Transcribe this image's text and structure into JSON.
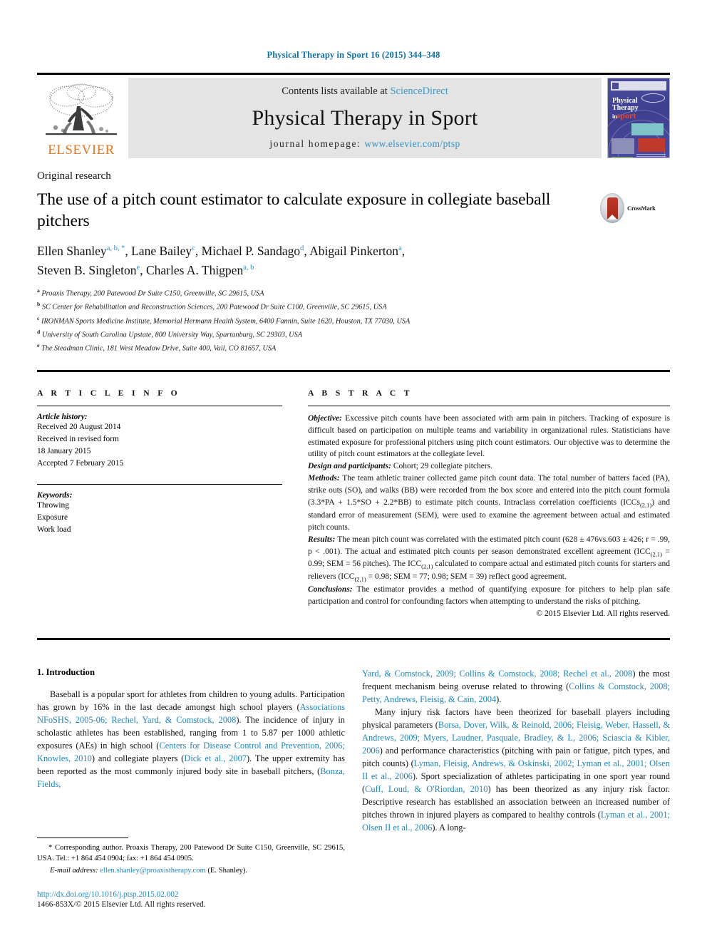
{
  "running_head": "Physical Therapy in Sport 16 (2015) 344–348",
  "masthead": {
    "contents_prefix": "Contents lists available at ",
    "sciencedirect": "ScienceDirect",
    "journal_title": "Physical Therapy in Sport",
    "homepage_prefix": "journal homepage: ",
    "homepage_url": "www.elsevier.com/ptsp",
    "publisher": "ELSEVIER",
    "cover_title_line1": "Physical",
    "cover_title_line2": "Therapy",
    "cover_title_line3_small": "in",
    "cover_title_line3_big": "sport"
  },
  "article": {
    "kicker": "Original research",
    "title": "The use of a pitch count estimator to calculate exposure in collegiate baseball pitchers",
    "crossmark_label": "CrossMark",
    "authors_line1": "Ellen Shanley",
    "authors": [
      {
        "name": "Ellen Shanley",
        "marks": "a, b, *"
      },
      {
        "name": "Lane Bailey",
        "marks": "c"
      },
      {
        "name": "Michael P. Sandago",
        "marks": "d"
      },
      {
        "name": "Abigail Pinkerton",
        "marks": "a"
      },
      {
        "name": "Steven B. Singleton",
        "marks": "e"
      },
      {
        "name": "Charles A. Thigpen",
        "marks": "a, b"
      }
    ],
    "affiliations": [
      {
        "mark": "a",
        "text": "Proaxis Therapy, 200 Patewood Dr Suite C150, Greenville, SC 29615, USA"
      },
      {
        "mark": "b",
        "text": "SC Center for Rehabilitation and Reconstruction Sciences, 200 Patewood Dr Suite C100, Greenville, SC 29615, USA"
      },
      {
        "mark": "c",
        "text": "IRONMAN Sports Medicine Institute, Memorial Hermann Health System, 6400 Fannin, Suite 1620, Houston, TX 77030, USA"
      },
      {
        "mark": "d",
        "text": "University of South Carolina Upstate, 800 University Way, Spartanburg, SC 29303, USA"
      },
      {
        "mark": "e",
        "text": "The Steadman Clinic, 181 West Meadow Drive, Suite 400, Vail, CO 81657, USA"
      }
    ]
  },
  "article_info": {
    "heading": "A R T I C L E    I N F O",
    "history_title": "Article history:",
    "history_lines": [
      "Received 20 August 2014",
      "Received in revised form",
      "18 January 2015",
      "Accepted 7 February 2015"
    ],
    "keywords_title": "Keywords:",
    "keywords": [
      "Throwing",
      "Exposure",
      "Work load"
    ]
  },
  "abstract": {
    "heading": "A B S T R A C T",
    "objective_label": "Objective:",
    "objective_text": " Excessive pitch counts have been associated with arm pain in pitchers. Tracking of exposure is difficult based on participation on multiple teams and variability in organizational rules. Statisticians have estimated exposure for professional pitchers using pitch count estimators. Our objective was to determine the utility of pitch count estimators at the collegiate level.",
    "design_label": "Design and participants:",
    "design_text": " Cohort; 29 collegiate pitchers.",
    "methods_label": "Methods:",
    "methods_text_a": " The team athletic trainer collected game pitch count data. The total number of batters faced (PA), strike outs (SO), and walks (BB) were recorded from the box score and entered into the pitch count formula (3.3*PA + 1.5*SO + 2.2*BB) to estimate pitch counts. Intraclass correlation coefficients (ICCs",
    "methods_sub_a": "(2,1)",
    "methods_text_b": ") and standard error of measurement (SEM), were used to examine the agreement between actual and estimated pitch counts.",
    "results_label": "Results:",
    "results_text_a": " The mean pitch count was correlated with the estimated pitch count (628 ± 476vs.603 ± 426; r = .99, p < .001). The actual and estimated pitch counts per season demonstrated excellent agreement (ICC",
    "results_sub_a": "(2,1)",
    "results_text_b": " = 0.99; SEM = 56 pitches). The ICC",
    "results_sub_b": "(2,1)",
    "results_text_c": " calculated to compare actual and estimated pitch counts for starters and relievers (ICC",
    "results_sub_c": "(2,1)",
    "results_text_d": " = 0.98; SEM = 77; 0.98; SEM = 39) reflect good agreement.",
    "conclusions_label": "Conclusions:",
    "conclusions_text": " The estimator provides a method of quantifying exposure for pitchers to help plan safe participation and control for confounding factors when attempting to understand the risks of pitching.",
    "copyright": "© 2015 Elsevier Ltd. All rights reserved."
  },
  "body": {
    "section_heading": "1. Introduction",
    "left_paragraph": {
      "seg1": "Baseball is a popular sport for athletes from children to young adults. Participation has grown by 16% in the last decade amongst high school players (",
      "cite1": "Associations NFoSHS, 2005-06; Rechel, Yard, & Comstock, 2008",
      "seg2": "). The incidence of injury in scholastic athletes has been established, ranging from 1 to 5.87 per 1000 athletic exposures (AEs) in high school (",
      "cite2": "Centers for Disease Control and Prevention, 2006; Knowles, 2010",
      "seg3": ") and collegiate players (",
      "cite3": "Dick et al., 2007",
      "seg4": "). The upper extremity has been reported as the most commonly injured body site in baseball pitchers, (",
      "cite4": "Bonza, Fields,"
    },
    "right_paragraph_1": {
      "cite_start": "Yard, & Comstock, 2009; Collins & Comstock, 2008; Rechel et al., 2008",
      "seg1": ") the most frequent mechanism being overuse related to throwing (",
      "cite2": "Collins & Comstock, 2008; Petty, Andrews, Fleisig, & Cain, 2004",
      "seg2": ")."
    },
    "right_paragraph_2": {
      "seg1": "Many injury risk factors have been theorized for baseball players including physical parameters (",
      "cite1": "Borsa, Dover, Wilk, & Reinold, 2006; Fleisig, Weber, Hassell, & Andrews, 2009; Myers, Laudner, Pasquale, Bradley, & L, 2006; Sciascia & Kibler, 2006",
      "seg2": ") and performance characteristics (pitching with pain or fatigue, pitch types, and pitch counts) (",
      "cite2": "Lyman, Fleisig, Andrews, & Oskinski, 2002; Lyman et al., 2001; Olsen II et al., 2006",
      "seg3": "). Sport specialization of athletes participating in one sport year round (",
      "cite3": "Cuff, Loud, & O'Riordan, 2010",
      "seg4": ") has been theorized as any injury risk factor. Descriptive research has established an association between an increased number of pitches thrown in injured players as compared to healthy controls (",
      "cite4": "Lyman et al., 2001; Olsen II et al., 2006",
      "seg5": "). A long-"
    }
  },
  "footnote": {
    "star": "*",
    "corresponding": " Corresponding author. Proaxis Therapy, 200 Patewood Dr Suite C150, Greenville, SC 29615, USA. Tel.: +1 864 454 0904; fax: +1 864 454 0905.",
    "email_label": "E-mail address:",
    "email": "ellen.shanley@proaxistherapy.com",
    "email_suffix": " (E. Shanley).",
    "doi": "http://dx.doi.org/10.1016/j.ptsp.2015.02.002",
    "issn": "1466-853X/© 2015 Elsevier Ltd. All rights reserved."
  },
  "colors": {
    "link_blue": "#1f86bd",
    "header_blue": "#0a72a8",
    "elsevier_orange": "#e87722",
    "sciencedirect_blue": "#3a9cd0"
  }
}
